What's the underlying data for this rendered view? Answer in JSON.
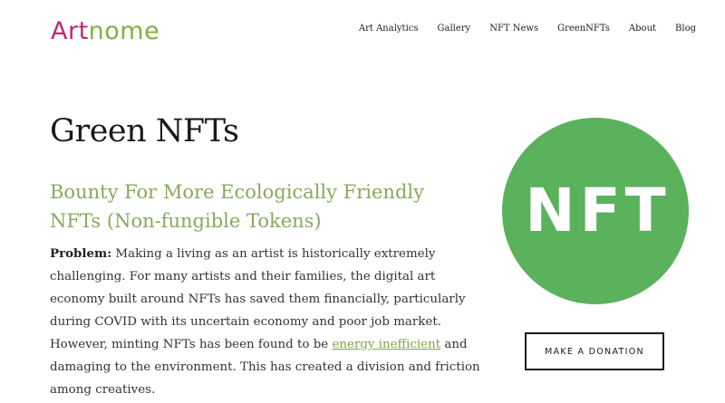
{
  "header": {
    "logo": {
      "part_a": "Art",
      "part_b": "nome"
    },
    "nav": [
      {
        "label": "Art Analytics"
      },
      {
        "label": "Gallery"
      },
      {
        "label": "NFT News"
      },
      {
        "label": "GreenNFTs"
      },
      {
        "label": "About"
      },
      {
        "label": "Blog"
      }
    ]
  },
  "main": {
    "title": "Green NFTs",
    "subtitle": "Bounty For More Ecologically Friendly NFTs (Non-fungible Tokens)",
    "problem_label": "Problem:",
    "problem_text_1": " Making a living as an artist is historically extremely challenging. For many artists and their families, the digital art economy built around NFTs has saved them financially, particularly during COVID with its uncertain economy and poor job market. However, minting NFTs has been found to be ",
    "problem_link": "energy inefficient",
    "problem_text_2": " and damaging to the environment. This has created a division and friction among creatives."
  },
  "sidebar": {
    "badge_text": "NFT",
    "donate_label": "MAKE A DONATION"
  },
  "colors": {
    "logo_accent_1": "#c3256e",
    "logo_accent_2": "#7fb241",
    "subtitle": "#88a85f",
    "badge": "#5bb25d"
  }
}
